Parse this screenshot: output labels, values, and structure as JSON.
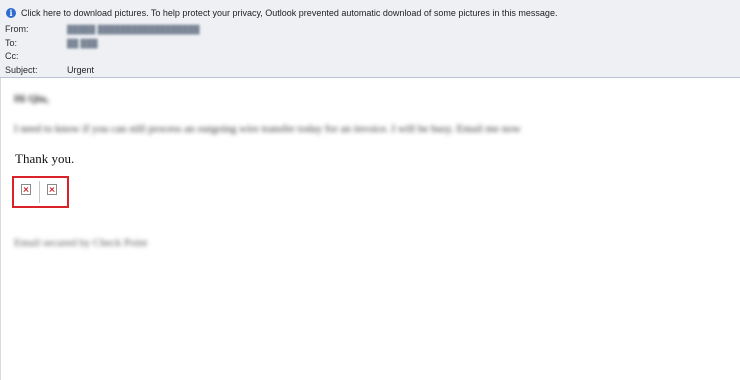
{
  "infobar": {
    "icon": "info-icon",
    "text": "Click here to download pictures. To help protect your privacy, Outlook prevented automatic download of some pictures in this message."
  },
  "header": {
    "from_label": "From:",
    "from_value": "█████ ██████████████████",
    "to_label": "To:",
    "to_value": "██ ███",
    "cc_label": "Cc:",
    "cc_value": "",
    "subject_label": "Subject:",
    "subject_value": "Urgent"
  },
  "body": {
    "greeting": "Hi Qiu,",
    "paragraph": "I need to know if you can still process an outgoing wire transfer today for an invoice. I will be busy. Email me now",
    "thanks": "Thank you.",
    "signature": "Email secured by Check Point",
    "blocked_images": [
      "broken-image-icon",
      "broken-image-icon"
    ]
  },
  "colors": {
    "header_bg": "#eef0f4",
    "highlight_box": "#d8232a",
    "info_icon": "#2d6bd0"
  }
}
